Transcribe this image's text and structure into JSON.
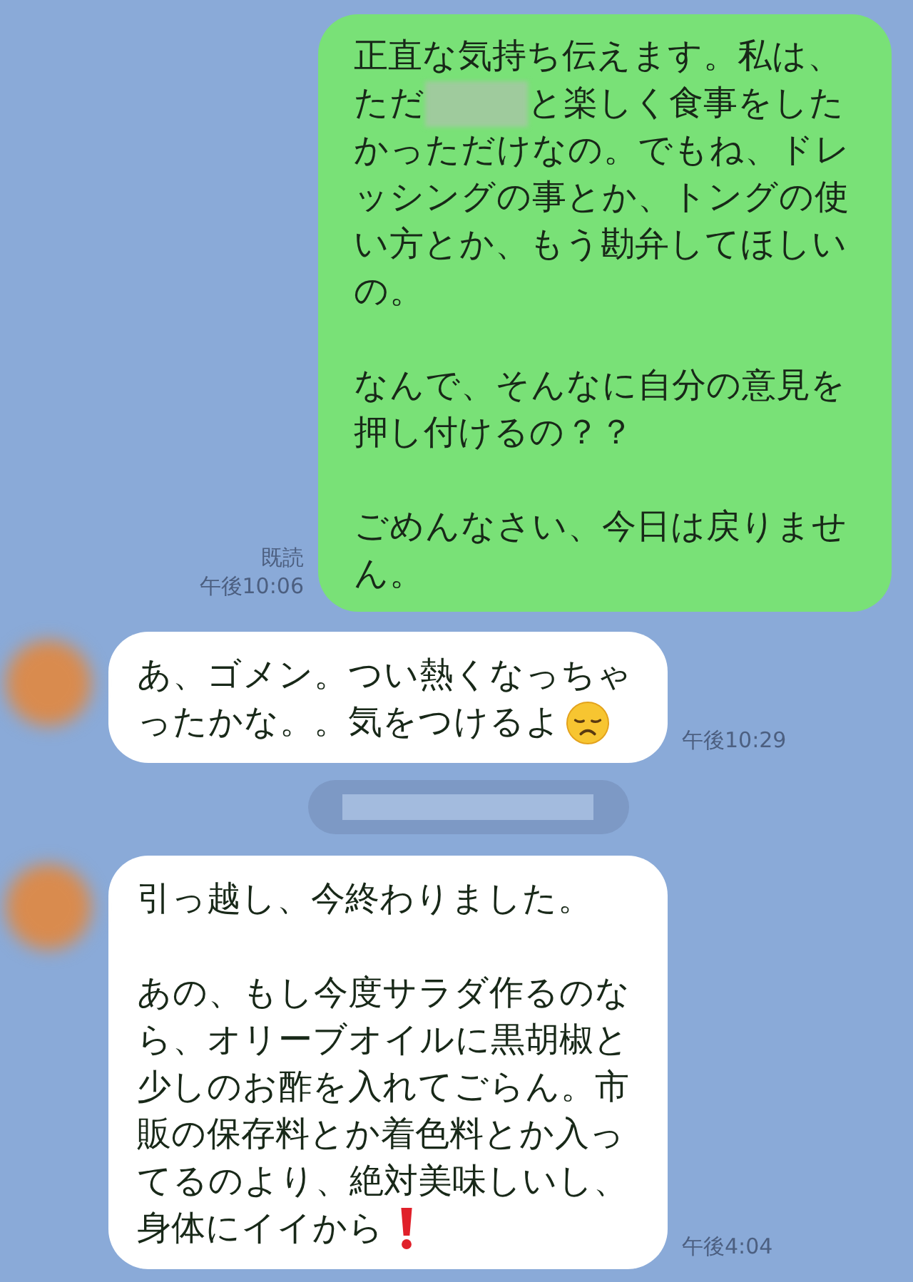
{
  "messages": [
    {
      "kind": "sent",
      "paragraphs": [
        [
          [
            {
              "kind": "text",
              "text": "正直な気持ち伝えます。私は、"
            }
          ],
          [
            {
              "kind": "text",
              "text": "ただ"
            },
            {
              "kind": "redacted"
            },
            {
              "kind": "text",
              "text": "と楽しく食事をした"
            }
          ],
          [
            {
              "kind": "text",
              "text": "かっただけなの。でもね、ドレッシングの事とか、トングの使い方とか、もう勘弁してほしいの。"
            }
          ]
        ],
        [
          [
            {
              "kind": "text",
              "text": "なんで、そんなに自分の意見を押し付けるの？？"
            }
          ]
        ],
        [
          [
            {
              "kind": "text",
              "text": "ごめんなさい、今日は戻りません。"
            }
          ]
        ]
      ],
      "read": "既読",
      "time": "午後10:06"
    },
    {
      "kind": "received",
      "paragraphs": [
        [
          [
            {
              "kind": "text",
              "text": "あ、ゴメン。つい熱くなっちゃ"
            }
          ],
          [
            {
              "kind": "text",
              "text": "ったかな。。気をつけるよ"
            },
            {
              "kind": "sad-emoji"
            }
          ]
        ]
      ],
      "time": "午後10:29"
    },
    {
      "kind": "separator"
    },
    {
      "kind": "received",
      "paragraphs": [
        [
          [
            {
              "kind": "text",
              "text": "引っ越し、今終わりました。"
            }
          ]
        ],
        [
          [
            {
              "kind": "text",
              "text": "あの、もし今度サラダ作るのなら、オリーブオイルに黒胡椒と少しのお酢を入れてごらん。市販の保存料とか着色料とか入ってるのより、絶対美味しいし、"
            }
          ],
          [
            {
              "kind": "text",
              "text": "身体にイイから"
            },
            {
              "kind": "exclamation-emoji"
            }
          ]
        ]
      ],
      "time": "午後4:04"
    }
  ]
}
